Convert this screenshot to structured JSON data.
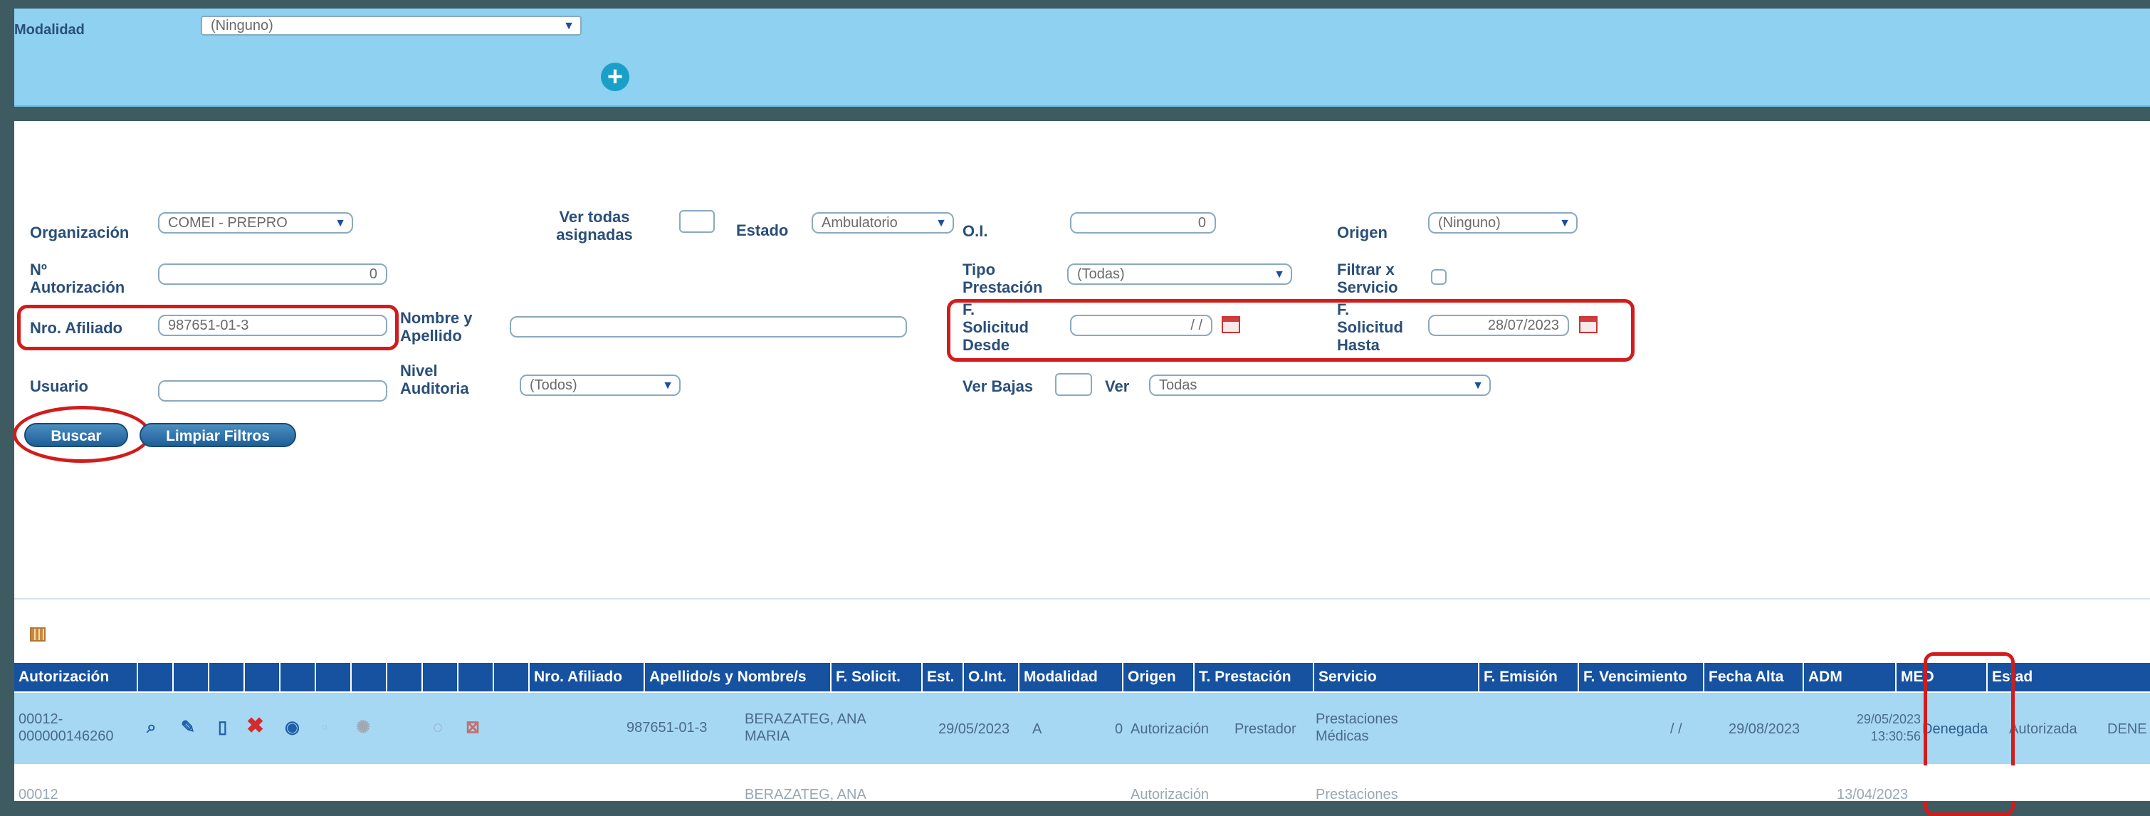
{
  "modalidad": {
    "label": "Modalidad",
    "value": "(Ninguno)",
    "add_icon": "plus-circle-icon"
  },
  "filters": {
    "organizacion": {
      "label": "Organización",
      "value": "COMEI - PREPRO"
    },
    "ver_todas": {
      "label_line1": "Ver todas",
      "label_line2": "asignadas"
    },
    "estado": {
      "label": "Estado",
      "value": "Ambulatorio"
    },
    "oi": {
      "label": "O.I.",
      "value": "0"
    },
    "origen": {
      "label": "Origen",
      "value": "(Ninguno)"
    },
    "nro_autorizacion": {
      "label_line1": "Nº",
      "label_line2": "Autorización",
      "value": "0"
    },
    "tipo_prestacion": {
      "label_line1": "Tipo",
      "label_line2": "Prestación",
      "value": "(Todas)"
    },
    "filtrar_servicio": {
      "label_line1": "Filtrar x",
      "label_line2": "Servicio"
    },
    "nro_afiliado": {
      "label": "Nro. Afiliado",
      "value": "987651-01-3"
    },
    "nombre_apellido": {
      "label_line1": "Nombre y",
      "label_line2": "Apellido",
      "value": ""
    },
    "f_solicitud_desde": {
      "label_line1": "F.",
      "label_line2": "Solicitud",
      "label_line3": "Desde",
      "value": "/ /"
    },
    "f_solicitud_hasta": {
      "label_line1": "F.",
      "label_line2": "Solicitud",
      "label_line3": "Hasta",
      "value": "28/07/2023"
    },
    "usuario": {
      "label": "Usuario",
      "value": ""
    },
    "nivel_auditoria": {
      "label_line1": "Nivel",
      "label_line2": "Auditoria",
      "value": "(Todos)"
    },
    "ver_bajas": {
      "label": "Ver Bajas"
    },
    "ver": {
      "label": "Ver",
      "value": "Todas"
    }
  },
  "buttons": {
    "buscar": "Buscar",
    "limpiar": "Limpiar Filtros"
  },
  "table": {
    "columns": [
      "Autorización",
      "",
      "",
      "",
      "",
      "",
      "",
      "",
      "",
      "",
      "",
      "",
      "Nro. Afiliado",
      "Apellido/s y Nombre/s",
      "F. Solicit.",
      "Est.",
      "O.Int.",
      "Modalidad",
      "Origen",
      "T. Prestación",
      "Servicio",
      "F. Emisión",
      "F. Vencimiento",
      "Fecha Alta",
      "ADM",
      "MED",
      "Estad"
    ],
    "rows": [
      {
        "autorizacion_line1": "00012-",
        "autorizacion_line2": "000000146260",
        "nro_afiliado": "987651-01-3",
        "nombre_line1": "BERAZATEG, ANA",
        "nombre_line2": "MARIA",
        "f_solicit": "29/05/2023",
        "est": "A",
        "o_int": "0",
        "modalidad": "Autorización",
        "origen": "Prestador",
        "t_prestacion_line1": "Prestaciones",
        "t_prestacion_line2": "Médicas",
        "servicio": "",
        "f_emision": "/ /",
        "f_vencimiento": "29/08/2023",
        "fecha_alta_line1": "29/05/2023",
        "fecha_alta_line2": "13:30:56",
        "adm": "Denegada",
        "med": "Autorizada",
        "estado": "DENE"
      },
      {
        "autorizacion_line1": "00012",
        "nombre_line1": "BERAZATEG, ANA",
        "modalidad": "Autorización",
        "t_prestacion_line1": "Prestaciones",
        "fecha_alta_line1": "13/04/2023"
      }
    ]
  },
  "colors": {
    "header_blue": "#1652a0",
    "top_panel": "#8ed1f0",
    "highlight": "#d21c1c",
    "row_selected": "#a6d8f3"
  }
}
